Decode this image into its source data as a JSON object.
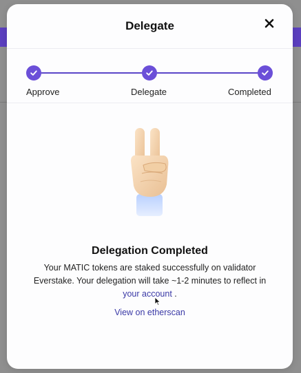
{
  "modal": {
    "title": "Delegate",
    "close_icon": "close-icon"
  },
  "stepper": {
    "steps": [
      {
        "label": "Approve",
        "state": "completed"
      },
      {
        "label": "Delegate",
        "state": "completed"
      },
      {
        "label": "Completed",
        "state": "completed"
      }
    ],
    "accent_color": "#6b4fd8"
  },
  "illustration": {
    "icon": "victory-hand-icon"
  },
  "result": {
    "title": "Delegation Completed",
    "message_prefix": "Your MATIC tokens are staked successfully on validator Everstake. Your delegation will take ~1-2 minutes to reflect in ",
    "account_link_label": "your account",
    "message_suffix": " .",
    "etherscan_link_label": "View on etherscan"
  },
  "colors": {
    "link": "#3a39a6",
    "brand_purple": "#5b3fbf"
  }
}
